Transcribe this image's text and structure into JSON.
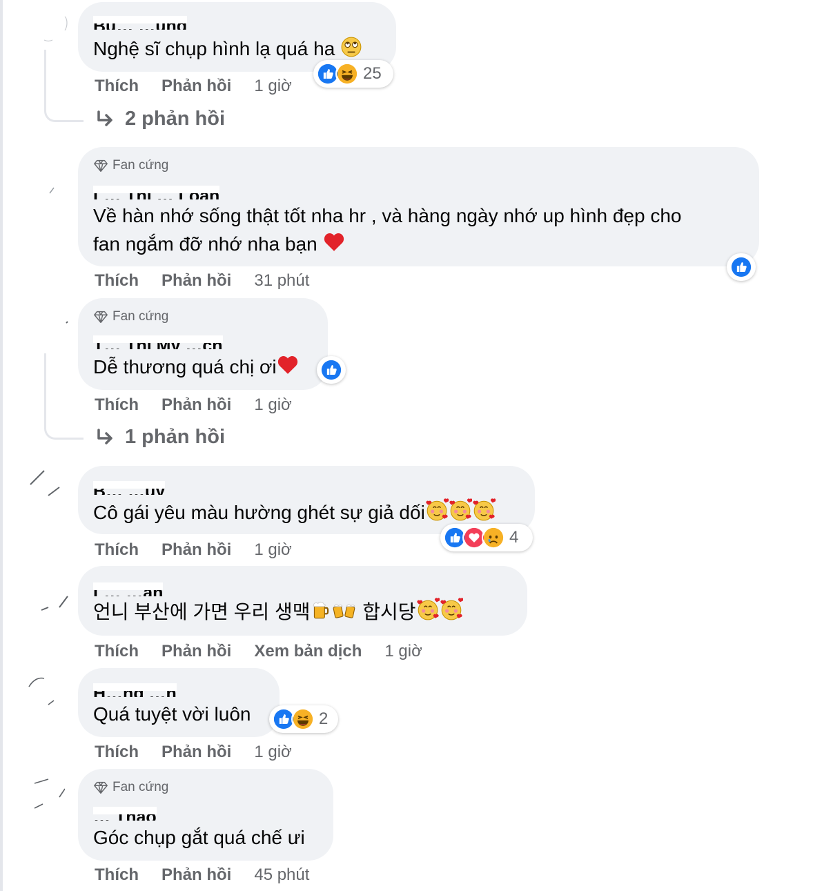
{
  "actions": {
    "like": "Thích",
    "reply": "Phản hồi",
    "translate": "Xem bản dịch"
  },
  "badge_label": "Fan cứng",
  "comments": [
    {
      "name": "Bu… …ung",
      "text": "Nghệ sĩ chụp hình lạ quá ha",
      "time": "1 giờ",
      "reaction_count": "25",
      "replies": "2 phản hồi"
    },
    {
      "name": "L… Thị … Loan",
      "text_line1": "Về hàn nhớ sống thật tốt nha hr , và hàng ngày nhớ up hình đẹp cho",
      "text_line2": "fan ngắm đỡ nhớ nha bạn",
      "time": "31 phút"
    },
    {
      "name": "T… Thị My …ch",
      "text": "Dễ thương quá chị ơi",
      "time": "1 giờ",
      "replies": "1 phản hồi"
    },
    {
      "name": "B… …uy",
      "text": "Cô gái yêu màu hường ghét sự giả dối",
      "time": "1 giờ",
      "reaction_count": "4"
    },
    {
      "name": "L… …an",
      "text_part1": "언니 부산에 가면 우리 생맥",
      "text_part2": "합시당",
      "time": "1 giờ"
    },
    {
      "name": "H…ng …n",
      "text": "Quá tuyệt vời luôn",
      "time": "1 giờ",
      "reaction_count": "2"
    },
    {
      "name": "… Thảo",
      "text": "Góc chụp gắt quá chế ưi",
      "time": "45 phút"
    }
  ],
  "colors": {
    "bubble": "#f0f2f5",
    "like_blue": "#1877f2",
    "muted_text": "#65676b",
    "love_red": "#f33e58",
    "haha_yellow": "#f7b125"
  }
}
